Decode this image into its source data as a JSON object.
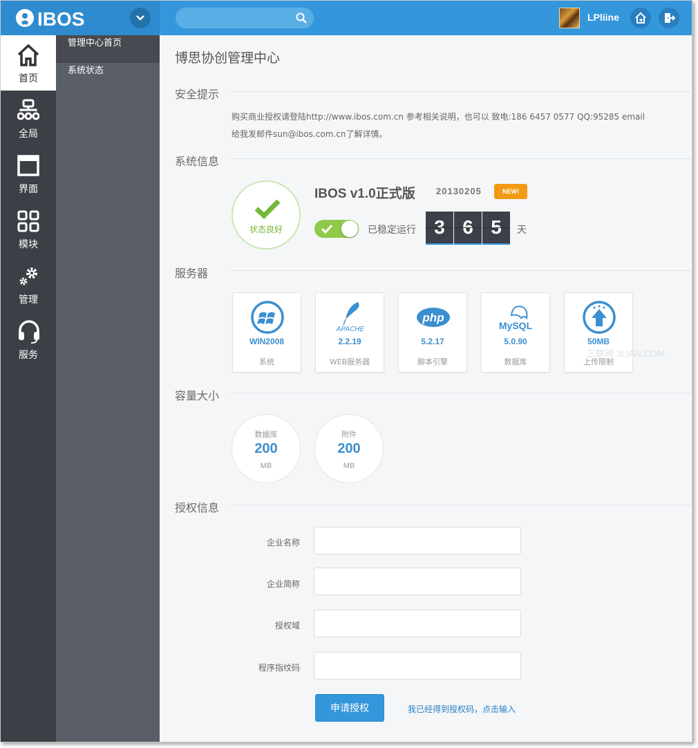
{
  "topbar": {
    "logo_text": "IBOS",
    "search_placeholder": "",
    "username": "LPliine"
  },
  "iconbar": {
    "items": [
      {
        "label": "首页",
        "icon": "home-icon"
      },
      {
        "label": "全局",
        "icon": "sitemap-icon"
      },
      {
        "label": "界面",
        "icon": "window-icon"
      },
      {
        "label": "模块",
        "icon": "grid-icon"
      },
      {
        "label": "管理",
        "icon": "gears-icon"
      },
      {
        "label": "服务",
        "icon": "headset-icon"
      }
    ]
  },
  "submenu": {
    "items": [
      {
        "label": "管理中心首页"
      },
      {
        "label": "系统状态"
      }
    ]
  },
  "main": {
    "title": "博思协创管理中心",
    "security": {
      "heading": "安全提示",
      "line1": "购买商业授权请登陆http://www.ibos.com.cn 参考相关说明，也可以  致电:186 6457 0577  QQ:95285  email",
      "line2": "给我发邮件sun@ibos.com.cn了解详情。"
    },
    "sysinfo": {
      "heading": "系统信息",
      "status_text": "状态良好",
      "version": "IBOS v1.0正式版",
      "build": "20130205",
      "new_badge": "NEW!",
      "uptime_label": "已稳定运行",
      "uptime_digits": [
        "3",
        "6",
        "5"
      ],
      "uptime_unit": "天"
    },
    "server": {
      "heading": "服务器",
      "cards": [
        {
          "value": "WIN2008",
          "label": "系统",
          "icon": "windows-icon"
        },
        {
          "value": "2.2.19",
          "label": "WEB服务器",
          "icon": "apache-icon",
          "icon_text": "APACHE"
        },
        {
          "value": "5.2.17",
          "label": "脚本引擎",
          "icon": "php-icon",
          "icon_text": "php"
        },
        {
          "value": "5.0.90",
          "label": "数据库",
          "icon": "mysql-icon",
          "icon_text": "MySQL"
        },
        {
          "value": "50MB",
          "label": "上传限制",
          "icon": "upload-icon"
        }
      ],
      "watermark": "三联网 3LIAN.COM"
    },
    "capacity": {
      "heading": "容量大小",
      "items": [
        {
          "label": "数据库",
          "value": "200",
          "unit": "MB"
        },
        {
          "label": "附件",
          "value": "200",
          "unit": "MB"
        }
      ]
    },
    "license": {
      "heading": "授权信息",
      "fields": [
        {
          "label": "企业名称",
          "value": ""
        },
        {
          "label": "企业简称",
          "value": ""
        },
        {
          "label": "授权域",
          "value": ""
        },
        {
          "label": "程序指纹码",
          "value": ""
        }
      ],
      "submit_label": "申请授权",
      "link_label": "我已经得到授权码，点击输入"
    }
  },
  "colors": {
    "brand_blue": "#3497db",
    "sidebar_dark": "#3b3f46",
    "submenu_gray": "#5a5e67",
    "status_green": "#74b73a",
    "badge_orange": "#f29a14"
  }
}
